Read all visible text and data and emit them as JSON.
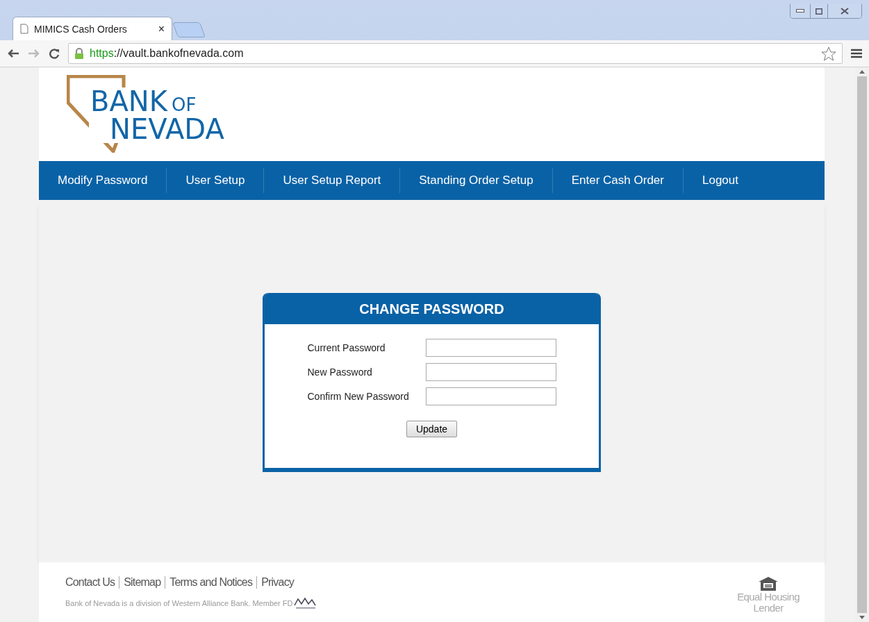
{
  "browser": {
    "tab": {
      "title": "MIMICS Cash Orders",
      "close": "×"
    },
    "url": {
      "scheme": "https",
      "rest": "://vault.bankofnevada.com",
      "secure": true
    }
  },
  "logo": {
    "word_1": "BANK",
    "word_2": "OF",
    "word_3": "NEVADA"
  },
  "nav": [
    {
      "label": "Modify Password"
    },
    {
      "label": "User Setup"
    },
    {
      "label": "User Setup Report"
    },
    {
      "label": "Standing Order Setup"
    },
    {
      "label": "Enter Cash Order"
    },
    {
      "label": "Logout"
    }
  ],
  "form": {
    "title": "CHANGE PASSWORD",
    "fields": [
      {
        "label": "Current Password"
      },
      {
        "label": "New Password"
      },
      {
        "label": "Confirm New Password"
      }
    ],
    "button": "Update"
  },
  "footer": {
    "links": [
      "Contact Us",
      "Sitemap",
      "Terms and Notices",
      "Privacy"
    ],
    "note": "Bank of Nevada is a division of Western Alliance Bank. Member FD",
    "ehl": [
      "Equal Housing",
      "Lender"
    ]
  }
}
